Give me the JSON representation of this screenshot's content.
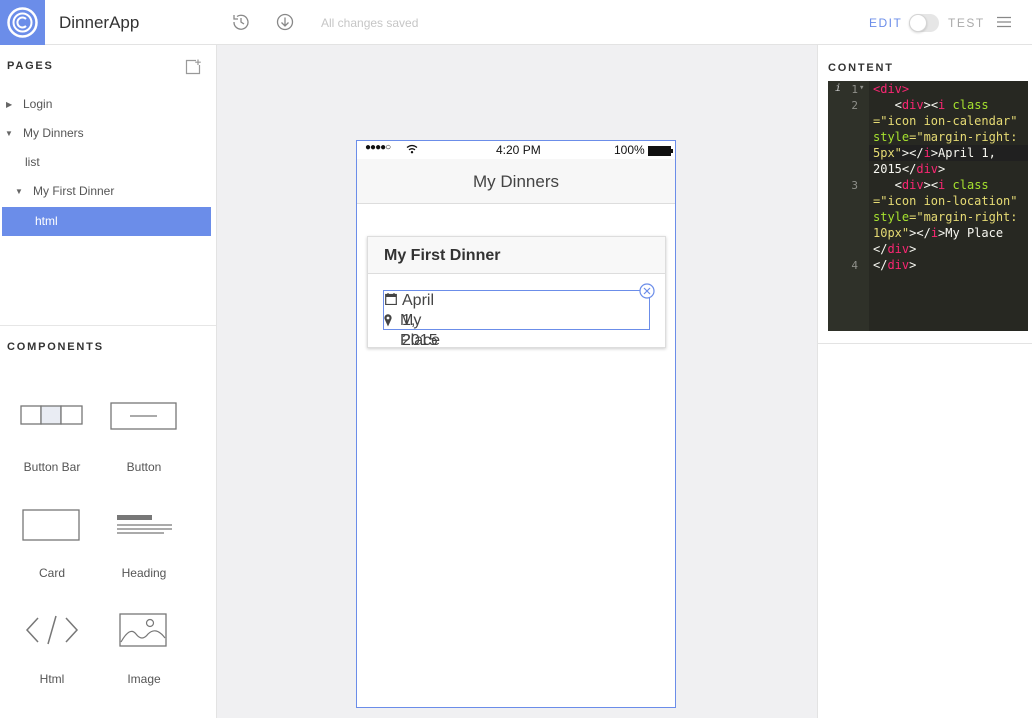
{
  "app": {
    "title": "DinnerApp"
  },
  "toolbar": {
    "save_status": "All changes saved",
    "history_icon": "history-icon",
    "download_icon": "download-icon",
    "mode_edit": "EDIT",
    "mode_test": "TEST",
    "menu_icon": "hamburger-menu-icon"
  },
  "pages": {
    "title": "PAGES",
    "items": [
      {
        "label": "Login",
        "expanded": false
      },
      {
        "label": "My Dinners",
        "expanded": true
      },
      {
        "label": "list"
      },
      {
        "label": "My First Dinner",
        "expanded": true
      },
      {
        "label": "html",
        "selected": true
      }
    ]
  },
  "components": {
    "title": "COMPONENTS",
    "items": [
      {
        "label": "Button Bar",
        "icon": "button-bar-icon"
      },
      {
        "label": "Button",
        "icon": "button-icon"
      },
      {
        "label": "Card",
        "icon": "card-icon"
      },
      {
        "label": "Heading",
        "icon": "heading-icon"
      },
      {
        "label": "Html",
        "icon": "html-code-icon"
      },
      {
        "label": "Image",
        "icon": "image-icon"
      }
    ]
  },
  "preview": {
    "status_bar": {
      "signal": "●●●●○",
      "time": "4:20 PM",
      "battery": "100%"
    },
    "nav_title": "My Dinners",
    "card": {
      "title": "My First Dinner",
      "lines": [
        {
          "icon": "calendar-icon",
          "text": "April 1, 2015"
        },
        {
          "icon": "location-icon",
          "text": "My Place"
        }
      ]
    }
  },
  "content_panel": {
    "title": "CONTENT",
    "line_numbers": [
      "1",
      "2",
      "3",
      "4"
    ]
  },
  "colors": {
    "accent": "#6b8de9",
    "editor_bg": "#272822",
    "canvas_bg": "#f0f0f2"
  }
}
